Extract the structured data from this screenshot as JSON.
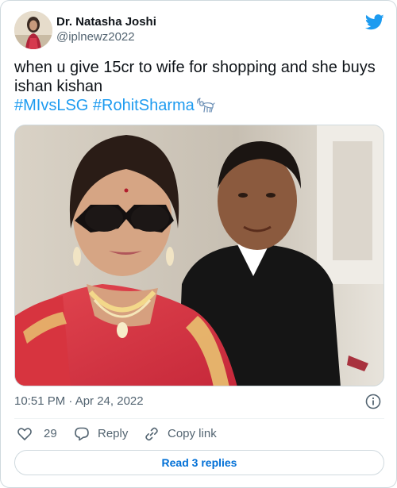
{
  "tweet": {
    "author": {
      "display_name": "Dr. Natasha Joshi",
      "handle": "@iplnewz2022"
    },
    "text_line": "when u give 15cr to wife for shopping and she buys ishan kishan",
    "hashtags": "#MIvsLSG #RohitSharma",
    "emoji_icon": "goat-emoji",
    "timestamp": "10:51 PM · Apr 24, 2022",
    "actions": {
      "like_count": "29",
      "reply_label": "Reply",
      "copy_link_label": "Copy link"
    },
    "read_replies_label": "Read 3 replies"
  },
  "colors": {
    "accent": "#1d9bf0",
    "link": "#006fd6",
    "muted": "#536471",
    "border": "#cfd9de"
  }
}
